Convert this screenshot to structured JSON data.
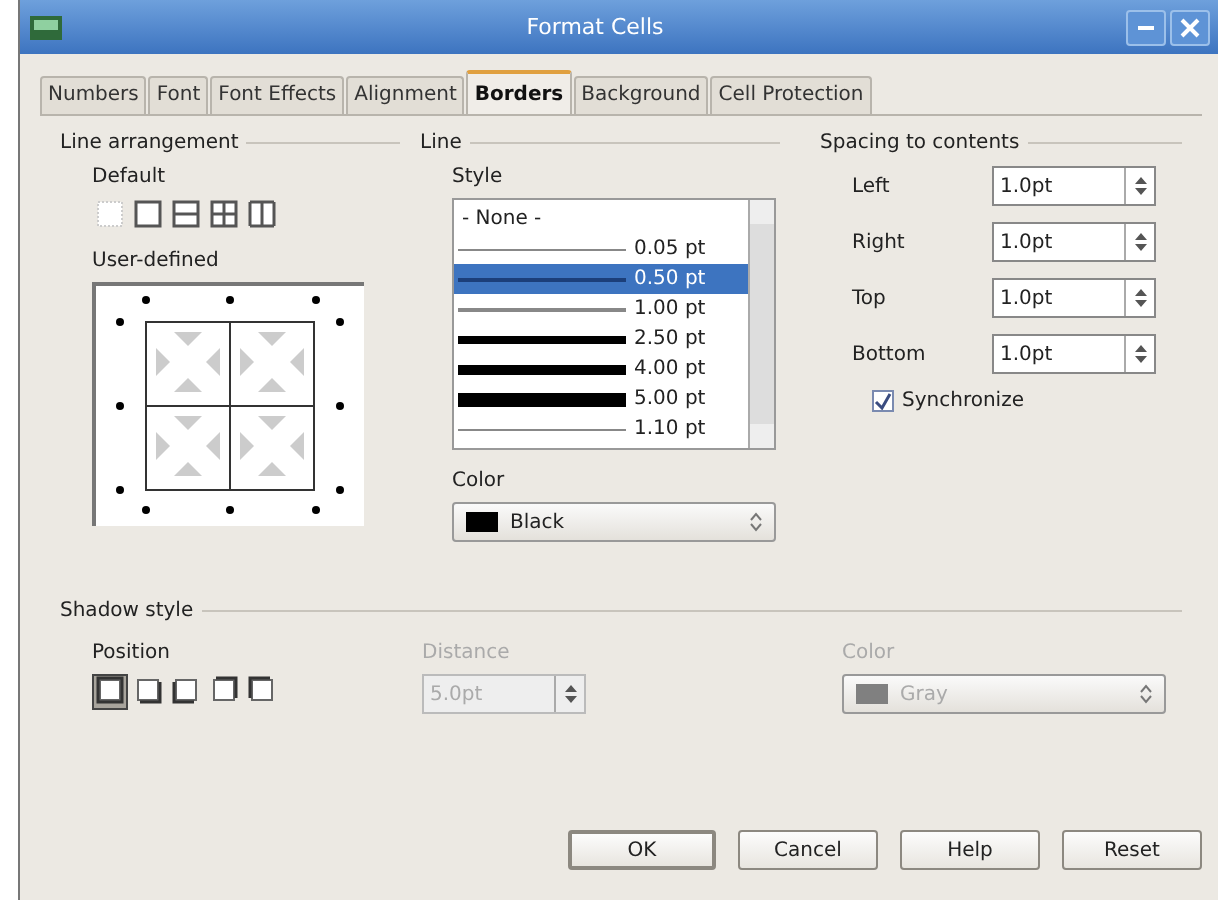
{
  "window": {
    "title": "Format Cells"
  },
  "tabs": [
    {
      "label": "Numbers",
      "selected": false
    },
    {
      "label": "Font",
      "selected": false
    },
    {
      "label": "Font Effects",
      "selected": false
    },
    {
      "label": "Alignment",
      "selected": false
    },
    {
      "label": "Borders",
      "selected": true
    },
    {
      "label": "Background",
      "selected": false
    },
    {
      "label": "Cell Protection",
      "selected": false
    }
  ],
  "line_arrangement": {
    "title": "Line arrangement",
    "default_label": "Default",
    "presets": [
      {
        "kind": "none"
      },
      {
        "kind": "outer"
      },
      {
        "kind": "rows"
      },
      {
        "kind": "all"
      },
      {
        "kind": "columns"
      }
    ],
    "user_defined_label": "User-defined"
  },
  "line": {
    "title": "Line",
    "style_label": "Style",
    "styles": [
      {
        "label": "- None -",
        "kind": "none",
        "selected": false
      },
      {
        "label": "0.05 pt",
        "kind": "hairline",
        "selected": false
      },
      {
        "label": "0.50 pt",
        "kind": "thin",
        "selected": true
      },
      {
        "label": "1.00 pt",
        "kind": "medium",
        "selected": false
      },
      {
        "label": "2.50 pt",
        "kind": "thick",
        "selected": false
      },
      {
        "label": "4.00 pt",
        "kind": "heavy",
        "selected": false
      },
      {
        "label": "5.00 pt",
        "kind": "bold",
        "selected": false
      },
      {
        "label": "1.10 pt",
        "kind": "hairline",
        "selected": false
      }
    ],
    "color_label": "Color",
    "color": {
      "label": "Black",
      "color": "#000000"
    }
  },
  "spacing": {
    "title": "Spacing to contents",
    "fields": [
      {
        "label": "Left",
        "value": "1.0pt"
      },
      {
        "label": "Right",
        "value": "1.0pt"
      },
      {
        "label": "Top",
        "value": "1.0pt"
      },
      {
        "label": "Bottom",
        "value": "1.0pt"
      }
    ],
    "synchronize": {
      "label": "Synchronize",
      "checked": true
    }
  },
  "shadow": {
    "title": "Shadow style",
    "position_label": "Position",
    "positions": [
      {
        "selected": true
      },
      {
        "selected": false
      },
      {
        "selected": false
      },
      {
        "selected": false
      },
      {
        "selected": false
      }
    ],
    "distance": {
      "label": "Distance",
      "value": "5.0pt",
      "disabled": true
    },
    "color": {
      "label": "Color",
      "value": "Gray",
      "color": "#808080",
      "disabled": true
    }
  },
  "buttons": [
    {
      "label": "OK",
      "kind": "ok"
    },
    {
      "label": "Cancel",
      "kind": "cancel"
    },
    {
      "label": "Help",
      "kind": "help"
    },
    {
      "label": "Reset",
      "kind": "reset"
    }
  ]
}
